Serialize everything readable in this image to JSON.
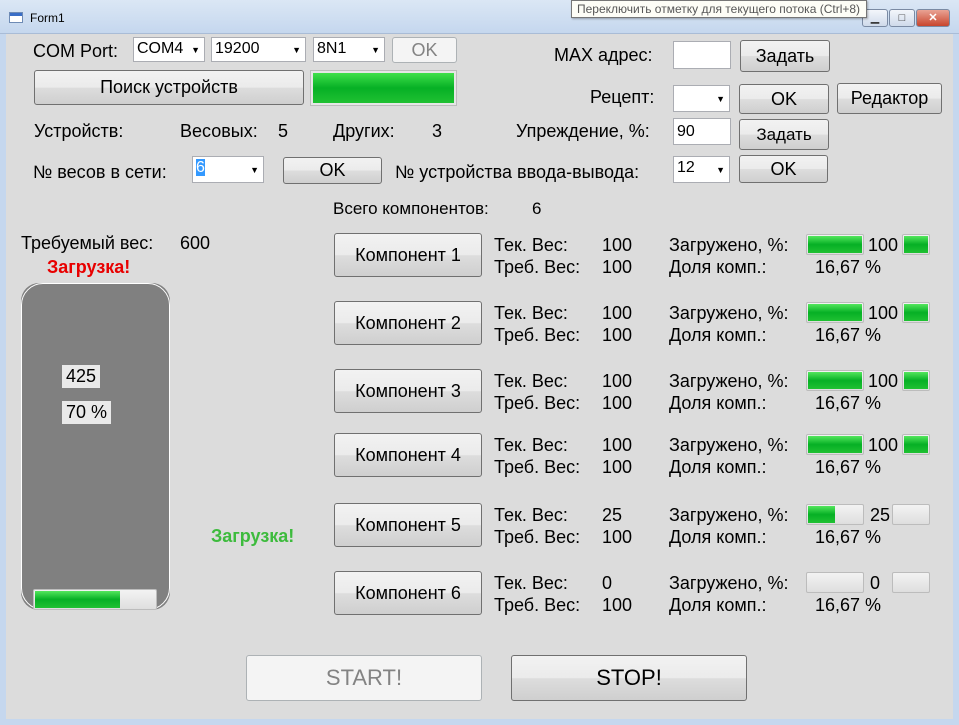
{
  "window": {
    "title": "Form1"
  },
  "tooltip": "Переключить отметку для текущего потока (Ctrl+8)",
  "com": {
    "label": "COM Port:",
    "port": "COM4",
    "baud": "19200",
    "format": "8N1",
    "ok_label": "OK"
  },
  "search_button": "Поиск устройств",
  "devices": {
    "label": "Устройств:",
    "scales_label": "Весовых:",
    "scales_count": "5",
    "other_label": "Других:",
    "other_count": "3"
  },
  "scale_num": {
    "label": "№ весов в сети:",
    "value": "6",
    "ok_label": "OK"
  },
  "io_device": {
    "label": "№ устройства ввода-вывода:",
    "value": "12",
    "ok_label": "OK"
  },
  "max_addr": {
    "label": "MAX адрес:",
    "value": "",
    "button": "Задать"
  },
  "recipe": {
    "label": "Рецепт:",
    "value": "",
    "ok_label": "OK",
    "editor_label": "Редактор"
  },
  "advance": {
    "label": "Упреждение, %:",
    "value": "90",
    "button": "Задать"
  },
  "total_components": {
    "label": "Всего компонентов:",
    "value": "6"
  },
  "required_weight": {
    "label": "Требуемый вес:",
    "value": "600"
  },
  "status_red": "Загрузка!",
  "status_green": "Загрузка!",
  "tank": {
    "weight": "425",
    "percent": "70 %",
    "fill_fraction": 0.71
  },
  "row_labels": {
    "cur": "Тек. Вес:",
    "req": "Треб. Вес:",
    "loaded": "Загружено, %:",
    "share": "Доля комп.:"
  },
  "components": [
    {
      "button": "Компонент 1",
      "cur": "100",
      "req": "100",
      "loaded": "100",
      "share": "16,67 %",
      "fill1": 1.0,
      "fill2": 1.0
    },
    {
      "button": "Компонент 2",
      "cur": "100",
      "req": "100",
      "loaded": "100",
      "share": "16,67 %",
      "fill1": 1.0,
      "fill2": 1.0
    },
    {
      "button": "Компонент 3",
      "cur": "100",
      "req": "100",
      "loaded": "100",
      "share": "16,67 %",
      "fill1": 1.0,
      "fill2": 1.0
    },
    {
      "button": "Компонент 4",
      "cur": "100",
      "req": "100",
      "loaded": "100",
      "share": "16,67 %",
      "fill1": 1.0,
      "fill2": 1.0
    },
    {
      "button": "Компонент 5",
      "cur": "25",
      "req": "100",
      "loaded": "25",
      "share": "16,67 %",
      "fill1": 0.5,
      "fill2": 0.0
    },
    {
      "button": "Компонент 6",
      "cur": "0",
      "req": "100",
      "loaded": "0",
      "share": "16,67 %",
      "fill1": 0.0,
      "fill2": 0.0
    }
  ],
  "start_label": "START!",
  "stop_label": "STOP!"
}
